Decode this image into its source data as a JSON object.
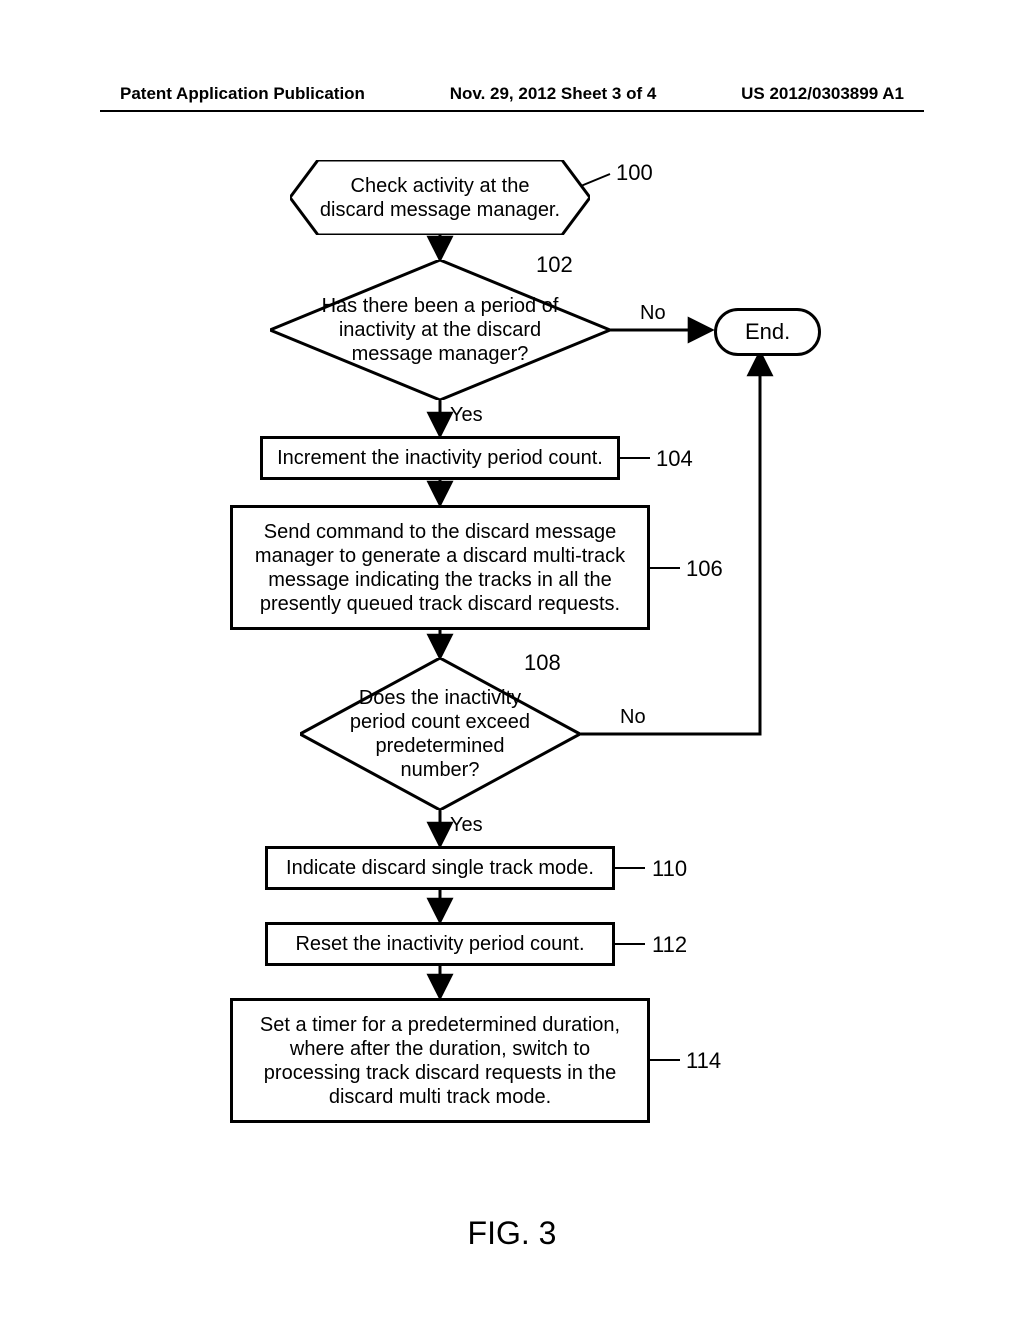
{
  "header": {
    "left": "Patent Application Publication",
    "center": "Nov. 29, 2012  Sheet 3 of 4",
    "right": "US 2012/0303899 A1"
  },
  "flow": {
    "n100": {
      "text": "Check activity at the discard message manager.",
      "ref": "100"
    },
    "n102": {
      "text": "Has there been a period of inactivity at the discard message manager?",
      "ref": "102",
      "yes": "Yes",
      "no": "No"
    },
    "end": {
      "text": "End."
    },
    "n104": {
      "text": "Increment the inactivity period count.",
      "ref": "104"
    },
    "n106": {
      "text": "Send command to the discard message manager to generate a discard multi-track message indicating the tracks in all the presently queued track discard requests.",
      "ref": "106"
    },
    "n108": {
      "text": "Does the inactivity period count exceed predetermined number?",
      "ref": "108",
      "yes": "Yes",
      "no": "No"
    },
    "n110": {
      "text": "Indicate discard single track mode.",
      "ref": "110"
    },
    "n112": {
      "text": "Reset the inactivity period count.",
      "ref": "112"
    },
    "n114": {
      "text": "Set a timer for a predetermined duration, where after the duration, switch to processing track discard requests in the discard multi track mode.",
      "ref": "114"
    }
  },
  "figure": "FIG. 3"
}
